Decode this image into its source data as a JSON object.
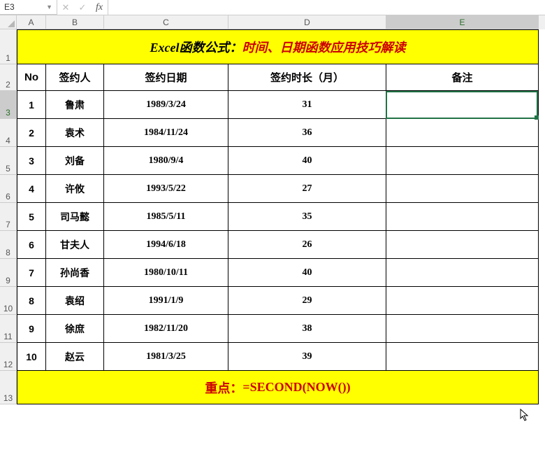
{
  "formula_bar": {
    "name_box": "E3",
    "cancel": "✕",
    "confirm": "✓",
    "fx": "fx",
    "value": ""
  },
  "columns": [
    "A",
    "B",
    "C",
    "D",
    "E"
  ],
  "row_numbers": [
    "1",
    "2",
    "3",
    "4",
    "5",
    "6",
    "7",
    "8",
    "9",
    "10",
    "11",
    "12",
    "13"
  ],
  "title": {
    "part1": "Excel函数公式：",
    "part2": "时间、日期函数应用技巧解读"
  },
  "headers": {
    "no": "No",
    "signer": "签约人",
    "date": "签约日期",
    "months": "签约时长（月）",
    "note": "备注"
  },
  "rows": [
    {
      "no": "1",
      "signer": "鲁肃",
      "date": "1989/3/24",
      "months": "31",
      "note": ""
    },
    {
      "no": "2",
      "signer": "袁术",
      "date": "1984/11/24",
      "months": "36",
      "note": ""
    },
    {
      "no": "3",
      "signer": "刘备",
      "date": "1980/9/4",
      "months": "40",
      "note": ""
    },
    {
      "no": "4",
      "signer": "许攸",
      "date": "1993/5/22",
      "months": "27",
      "note": ""
    },
    {
      "no": "5",
      "signer": "司马懿",
      "date": "1985/5/11",
      "months": "35",
      "note": ""
    },
    {
      "no": "6",
      "signer": "甘夫人",
      "date": "1994/6/18",
      "months": "26",
      "note": ""
    },
    {
      "no": "7",
      "signer": "孙尚香",
      "date": "1980/10/11",
      "months": "40",
      "note": ""
    },
    {
      "no": "8",
      "signer": "袁绍",
      "date": "1991/1/9",
      "months": "29",
      "note": ""
    },
    {
      "no": "9",
      "signer": "徐庶",
      "date": "1982/11/20",
      "months": "38",
      "note": ""
    },
    {
      "no": "10",
      "signer": "赵云",
      "date": "1981/3/25",
      "months": "39",
      "note": ""
    }
  ],
  "footer": {
    "part1": "重点：",
    "part2": "=SECOND(NOW())"
  },
  "selected_cell": "E3",
  "selected_col": "E",
  "selected_row": "3",
  "chart_data": {
    "type": "table",
    "categories": [
      "No",
      "签约人",
      "签约日期",
      "签约时长（月）",
      "备注"
    ],
    "series": [
      {
        "name": "No",
        "values": [
          1,
          2,
          3,
          4,
          5,
          6,
          7,
          8,
          9,
          10
        ]
      },
      {
        "name": "签约人",
        "values": [
          "鲁肃",
          "袁术",
          "刘备",
          "许攸",
          "司马懿",
          "甘夫人",
          "孙尚香",
          "袁绍",
          "徐庶",
          "赵云"
        ]
      },
      {
        "name": "签约日期",
        "values": [
          "1989/3/24",
          "1984/11/24",
          "1980/9/4",
          "1993/5/22",
          "1985/5/11",
          "1994/6/18",
          "1980/10/11",
          "1991/1/9",
          "1982/11/20",
          "1981/3/25"
        ]
      },
      {
        "name": "签约时长（月）",
        "values": [
          31,
          36,
          40,
          27,
          35,
          26,
          40,
          29,
          38,
          39
        ]
      }
    ],
    "title": "Excel函数公式：时间、日期函数应用技巧解读"
  }
}
